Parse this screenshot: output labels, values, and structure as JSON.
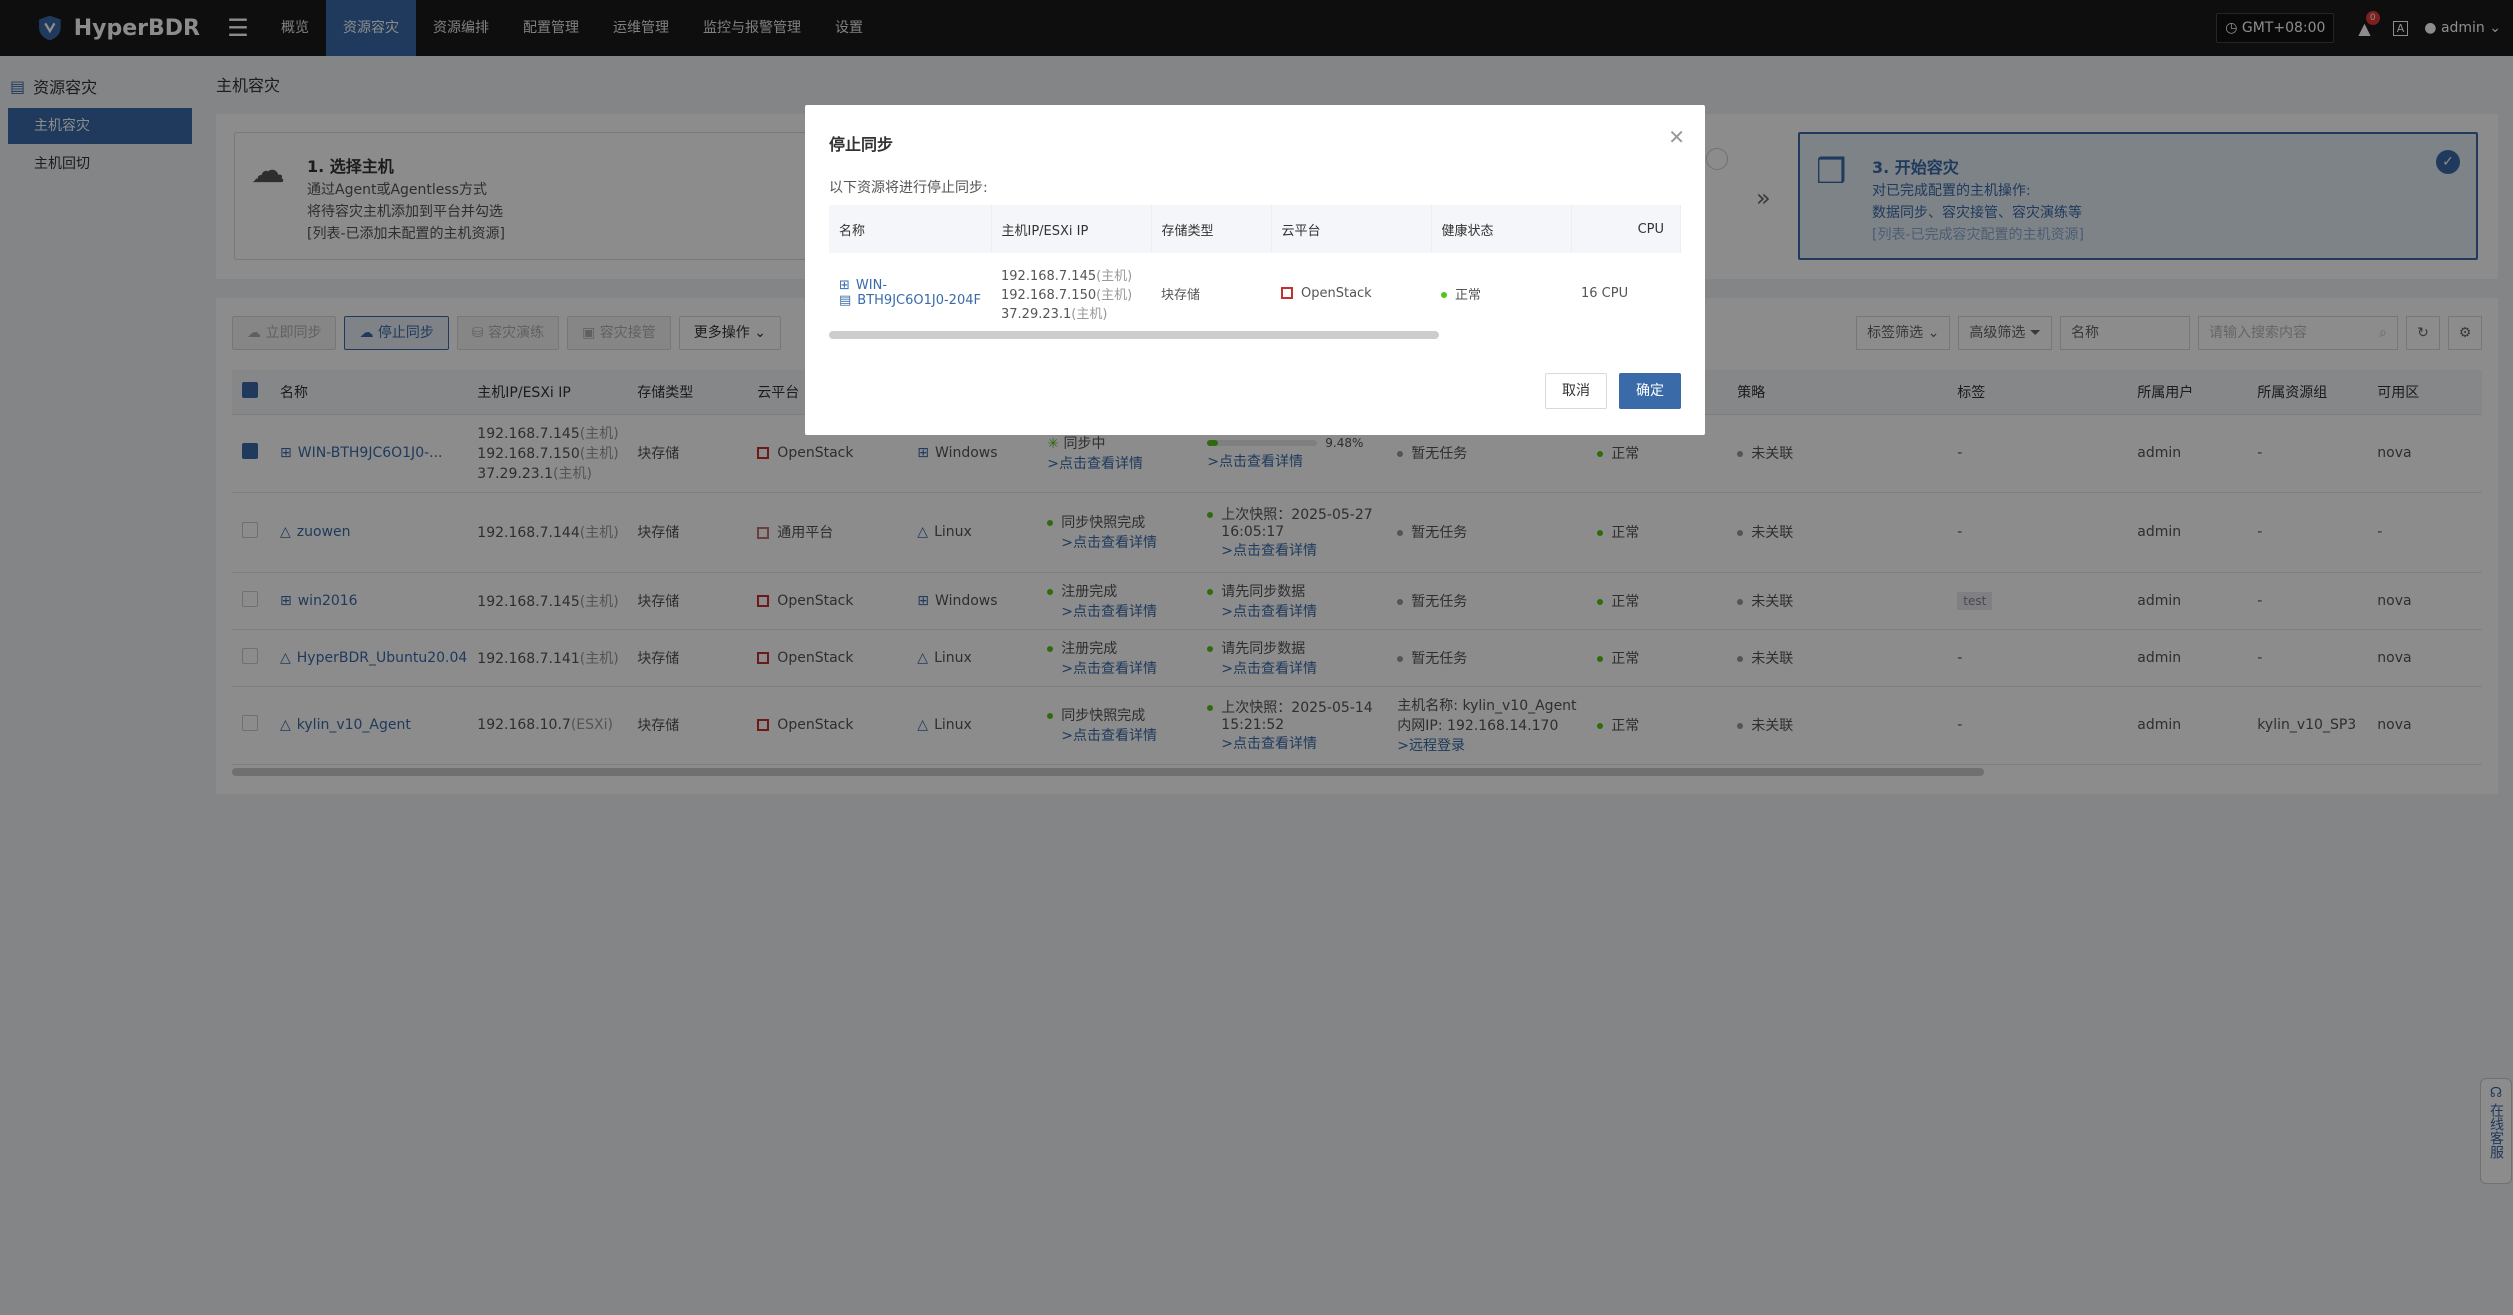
{
  "brand": {
    "name": "HyperBDR"
  },
  "nav": [
    "概览",
    "资源容灾",
    "资源编排",
    "配置管理",
    "运维管理",
    "监控与报警管理",
    "设置"
  ],
  "top": {
    "timezone": "GMT+08:00",
    "bell_count": "0",
    "lang_badge": "A",
    "user": "admin"
  },
  "sidebar": {
    "group": "资源容灾",
    "items": [
      "主机容灾",
      "主机回切"
    ]
  },
  "page_title": "主机容灾",
  "steps": {
    "s1": {
      "title": "1. 选择主机",
      "lines": [
        "通过Agent或Agentless方式",
        "将待容灾主机添加到平台并勾选",
        "[列表-已添加未配置的主机资源]"
      ]
    },
    "s3": {
      "title": "3. 开始容灾",
      "lines": [
        "对已完成配置的主机操作:",
        "数据同步、容灾接管、容灾演练等",
        "[列表-已完成容灾配置的主机资源]"
      ]
    }
  },
  "toolbar": {
    "sync_now": "立即同步",
    "stop_sync": "停止同步",
    "drill": "容灾演练",
    "takeover": "容灾接管",
    "more": "更多操作"
  },
  "toolbar_right": {
    "tag_filter": "标签筛选",
    "adv_filter": "高级筛选",
    "field": "名称",
    "search_placeholder": "请输入搜索内容"
  },
  "columns": [
    "名称",
    "主机IP/ESXi IP",
    "存储类型",
    "云平台",
    "",
    "",
    "",
    "",
    "健康状态",
    "策略",
    "标签",
    "所属用户",
    "所属资源组",
    "可用区"
  ],
  "rows": [
    {
      "name": "WIN-BTH9JC6O1J0-...",
      "ips": [
        "192.168.7.145",
        "192.168.7.150",
        "37.29.23.1"
      ],
      "ip_suffix": "(主机)",
      "storage": "块存储",
      "cloud": "OpenStack",
      "os": "Windows",
      "status": "同步中",
      "detail": ">点击查看详情",
      "progress_text": "9.48%",
      "progress": 0.0948,
      "sync_detail": ">点击查看详情",
      "task": "暂无任务",
      "health": "正常",
      "policy": "未关联",
      "tag": "-",
      "user": "admin",
      "group": "-",
      "zone": "nova",
      "checked": true
    },
    {
      "name": "zuowen",
      "ips": [
        "192.168.7.144"
      ],
      "ip_suffix": "(主机)",
      "storage": "块存储",
      "cloud": "通用平台",
      "os": "Linux",
      "status": "同步快照完成",
      "detail": ">点击查看详情",
      "sync_line1": "上次快照：2025-05-27",
      "sync_line2": "16:05:17",
      "sync_detail": ">点击查看详情",
      "task": "暂无任务",
      "health": "正常",
      "policy": "未关联",
      "tag": "-",
      "user": "admin",
      "group": "-",
      "zone": "-",
      "checked": false
    },
    {
      "name": "win2016",
      "ips": [
        "192.168.7.145"
      ],
      "ip_suffix": "(主机)",
      "storage": "块存储",
      "cloud": "OpenStack",
      "os": "Windows",
      "status": "注册完成",
      "detail": ">点击查看详情",
      "sync_line1": "请先同步数据",
      "sync_detail": ">点击查看详情",
      "task": "暂无任务",
      "health": "正常",
      "policy": "未关联",
      "tag": "test",
      "user": "admin",
      "group": "-",
      "zone": "nova",
      "checked": false
    },
    {
      "name": "HyperBDR_Ubuntu20.04",
      "ips": [
        "192.168.7.141"
      ],
      "ip_suffix": "(主机)",
      "storage": "块存储",
      "cloud": "OpenStack",
      "os": "Linux",
      "status": "注册完成",
      "detail": ">点击查看详情",
      "sync_line1": "请先同步数据",
      "sync_detail": ">点击查看详情",
      "task": "暂无任务",
      "health": "正常",
      "policy": "未关联",
      "tag": "-",
      "user": "admin",
      "group": "-",
      "zone": "nova",
      "checked": false
    },
    {
      "name": "kylin_v10_Agent",
      "ips": [
        "192.168.10.7"
      ],
      "ip_suffix": "(ESXi)",
      "storage": "块存储",
      "cloud": "OpenStack",
      "os": "Linux",
      "status": "同步快照完成",
      "detail": ">点击查看详情",
      "sync_line1": "上次快照：2025-05-14",
      "sync_line2": "15:21:52",
      "sync_detail": ">点击查看详情",
      "task": "主机名称: kylin_v10_Agent",
      "task2": "内网IP: 192.168.14.170",
      "task3": ">远程登录",
      "health": "正常",
      "policy": "未关联",
      "tag": "-",
      "user": "admin",
      "group": "kylin_v10_SP3",
      "zone": "nova",
      "checked": false
    }
  ],
  "modal": {
    "title": "停止同步",
    "desc": "以下资源将进行停止同步:",
    "columns": [
      "名称",
      "主机IP/ESXi IP",
      "存储类型",
      "云平台",
      "健康状态",
      "CPU"
    ],
    "row": {
      "name1": "WIN-",
      "name2": "BTH9JC6O1J0-204F",
      "ips": [
        "192.168.7.145",
        "192.168.7.150",
        "37.29.23.1"
      ],
      "ip_suffix": "(主机)",
      "storage": "块存储",
      "cloud": "OpenStack",
      "health": "正常",
      "cpu": "16 CPU"
    },
    "cancel": "取消",
    "confirm": "确定"
  },
  "service": "在线客服"
}
